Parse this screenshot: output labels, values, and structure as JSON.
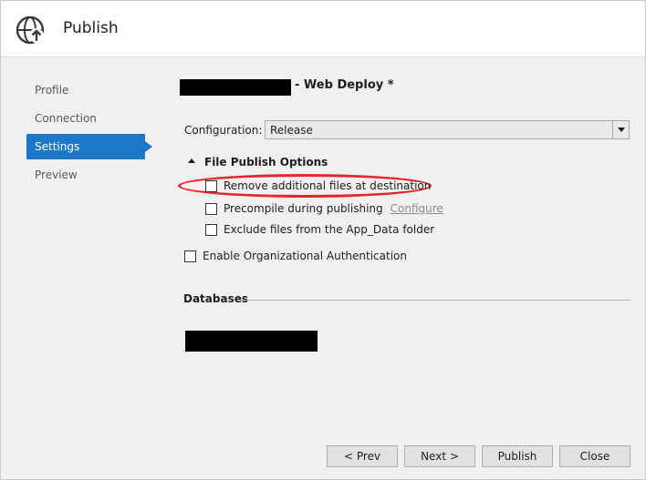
{
  "window": {
    "title": "Publish"
  },
  "nav": {
    "items": [
      {
        "label": "Profile",
        "active": false
      },
      {
        "label": "Connection",
        "active": false
      },
      {
        "label": "Settings",
        "active": true
      },
      {
        "label": "Preview",
        "active": false
      }
    ]
  },
  "profile": {
    "suffix": "- Web Deploy *"
  },
  "configuration": {
    "label": "Configuration:",
    "value": "Release"
  },
  "file_publish_options": {
    "title": "File Publish Options",
    "remove_additional": {
      "label": "Remove additional files at destination",
      "checked": false
    },
    "precompile": {
      "label": "Precompile during publishing",
      "checked": false,
      "link": "Configure"
    },
    "exclude_app_data": {
      "label": "Exclude files from the App_Data folder",
      "checked": false
    }
  },
  "org_auth": {
    "label": "Enable Organizational Authentication",
    "checked": false
  },
  "databases": {
    "title": "Databases"
  },
  "footer": {
    "prev": "< Prev",
    "next": "Next >",
    "publish": "Publish",
    "close": "Close"
  },
  "colors": {
    "accent": "#1e78c8",
    "highlight": "#e8252b"
  },
  "icons": {
    "header": "globe-upload-icon",
    "section_toggle": "caret-up-icon",
    "dropdown": "chevron-down-icon"
  }
}
